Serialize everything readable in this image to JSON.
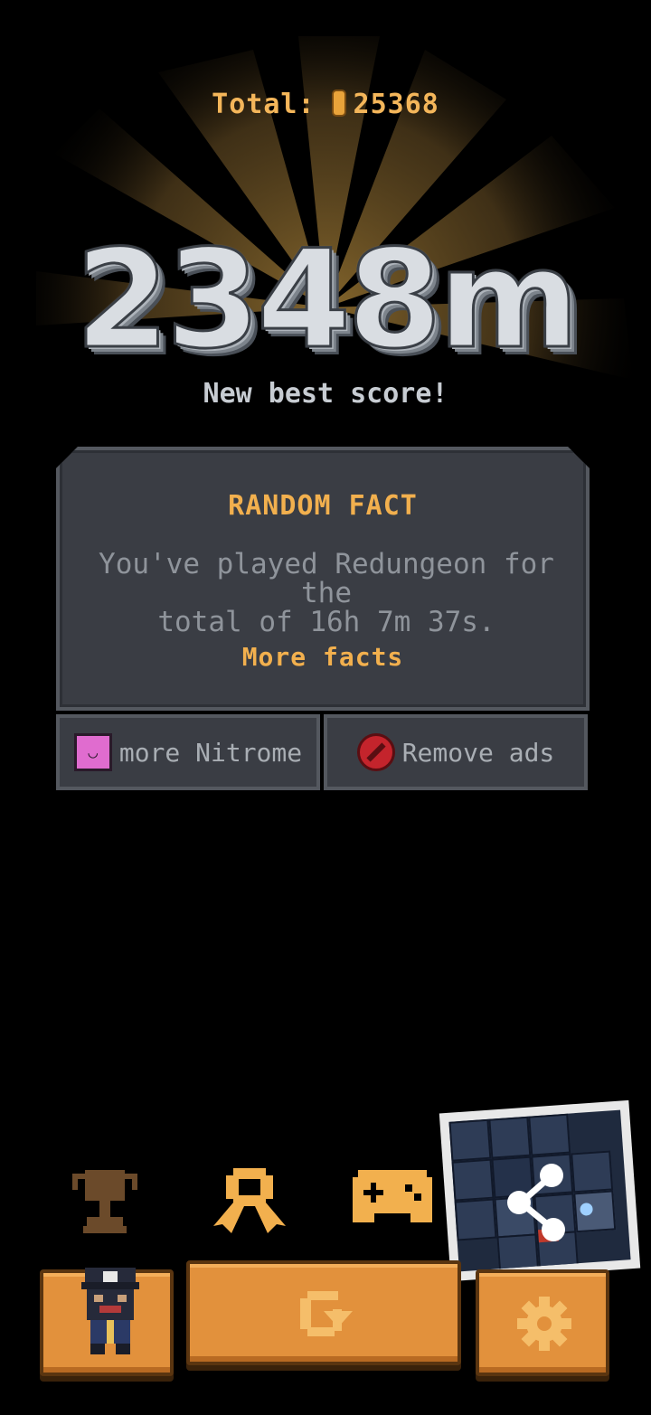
{
  "header": {
    "total_label": "Total:",
    "total_value": "25368",
    "score": "2348m",
    "subtitle": "New best score!"
  },
  "fact_panel": {
    "heading": "RANDOM FACT",
    "line1": "You've played Redungeon for the",
    "line2": "total of 16h 7m 37s.",
    "more_link": "More facts"
  },
  "secondary_buttons": {
    "nitrome_label": "more Nitrome",
    "ads_label": "Remove ads"
  },
  "icons": {
    "trophy": "trophy-icon",
    "award": "award-ribbon-icon",
    "gamepad": "gamepad-icon",
    "share": "share-icon",
    "replay": "replay-icon",
    "settings": "gear-icon",
    "character": "character-avatar-icon"
  },
  "colors": {
    "accent": "#f2b04e",
    "button": "#e2913c",
    "panel": "#3a3d44",
    "trophy_disabled": "#6b4a2a"
  }
}
